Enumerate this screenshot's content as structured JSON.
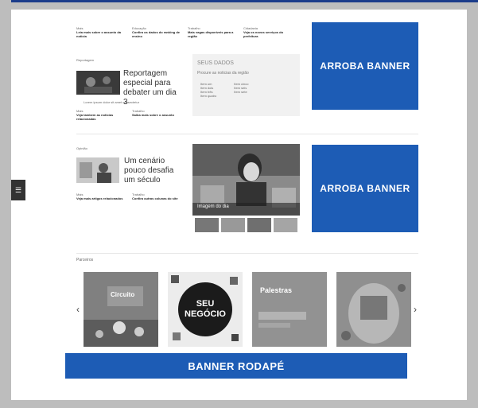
{
  "banners": {
    "top_right": "ARROBA BANNER",
    "mid_right": "ARROBA BANNER",
    "footer": "BANNER RODAPÉ"
  },
  "top_columns": [
    {
      "label": "Mais",
      "text": "Leia mais sobre o assunto da noticia"
    },
    {
      "label": "Educação",
      "text": "Confira os dados do ranking de ensino"
    },
    {
      "label": "Trabalho",
      "text": "Mais vagas disponiveis para a região"
    },
    {
      "label": "Cidadania",
      "text": "Veja os novos serviços da prefeitura"
    }
  ],
  "story1": {
    "kicker": "Reportagem",
    "headline": "Reportagem especial para debater um dia 3",
    "sub": "Lorem ipsum dolor sit amet consectetur",
    "links": [
      {
        "label": "Mais",
        "text": "Veja tambem as noticias relacionadas"
      },
      {
        "label": "Trabalho",
        "text": "Saiba mais sobre o assunto"
      }
    ]
  },
  "search_box": {
    "title": "SEUS DADOS",
    "subtitle": "Procure as noticias da região",
    "list_left": [
      "Item um",
      "Item dois",
      "Item três",
      "Item quatro"
    ],
    "list_right": [
      "Item cinco",
      "Item seis",
      "Item sete"
    ]
  },
  "story2": {
    "kicker": "Opinião",
    "headline": "Um cenário pouco desafia um século",
    "links": [
      {
        "label": "Mais",
        "text": "Veja mais artigos relacionados"
      },
      {
        "label": "Trabalho",
        "text": "Confira outras colunas do site"
      }
    ]
  },
  "gallery_caption": "Imagem do dia",
  "section_title": "Parceiros",
  "tiles": [
    {
      "name": "tile-1",
      "text": "Circuito"
    },
    {
      "name": "tile-2",
      "text": "SEU NEGÓCIO"
    },
    {
      "name": "tile-3",
      "text": "Palestras"
    },
    {
      "name": "tile-4",
      "text": ""
    }
  ],
  "colors": {
    "brand": "#1d5cb5",
    "frame": "#bdbdbd"
  }
}
